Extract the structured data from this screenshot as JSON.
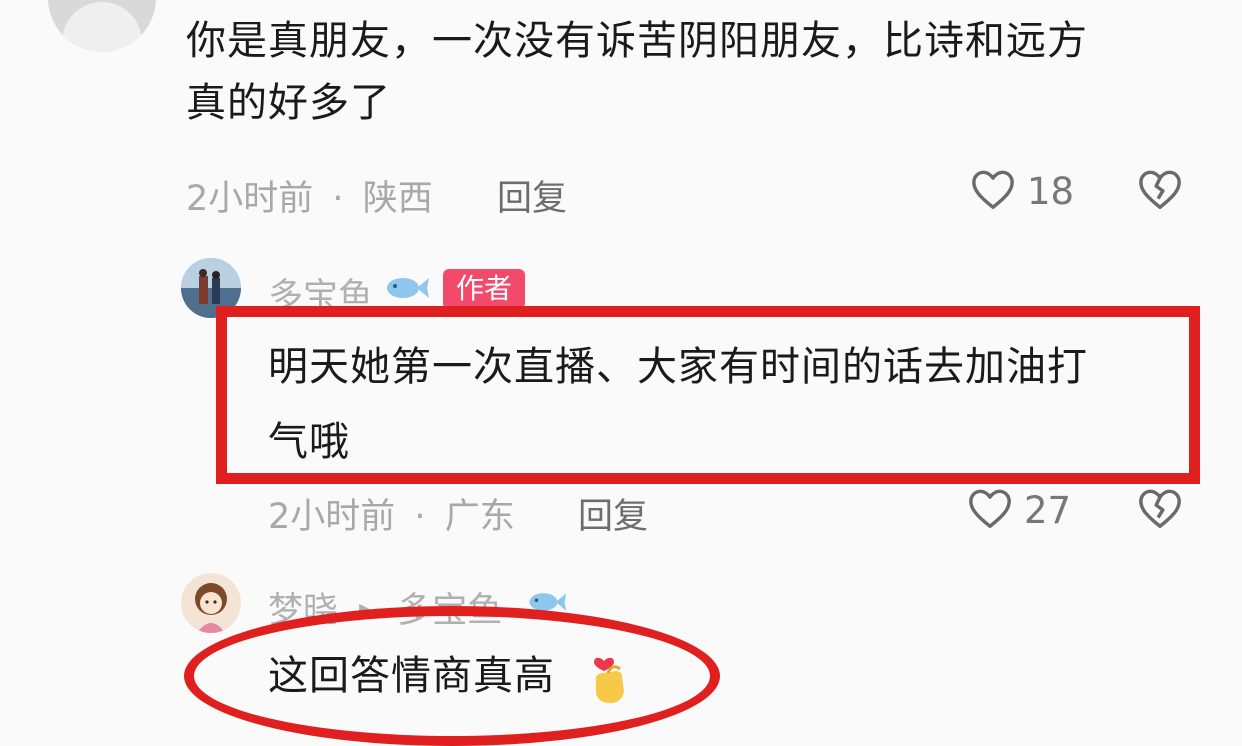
{
  "comment_1": {
    "text_line1": "你是真朋友，一次没有诉苦阴阳朋友，比诗和远方",
    "text_line2": "真的好多了",
    "time": "2小时前",
    "location": "陕西",
    "reply_label": "回复",
    "likes": "18"
  },
  "comment_2": {
    "username": "多宝鱼",
    "badge": "作者",
    "text_line1": "明天她第一次直播、大家有时间的话去加油打",
    "text_line2": "气哦",
    "time": "2小时前",
    "location": "广东",
    "reply_label": "回复",
    "likes": "27"
  },
  "comment_3": {
    "username": "梦晓",
    "reply_to": "多宝鱼",
    "text": "这回答情商真高"
  },
  "separator": "·",
  "colors": {
    "annotation_red": "#e01f1f",
    "author_badge": "#f24a6b",
    "meta_gray": "#a8a8a8"
  }
}
